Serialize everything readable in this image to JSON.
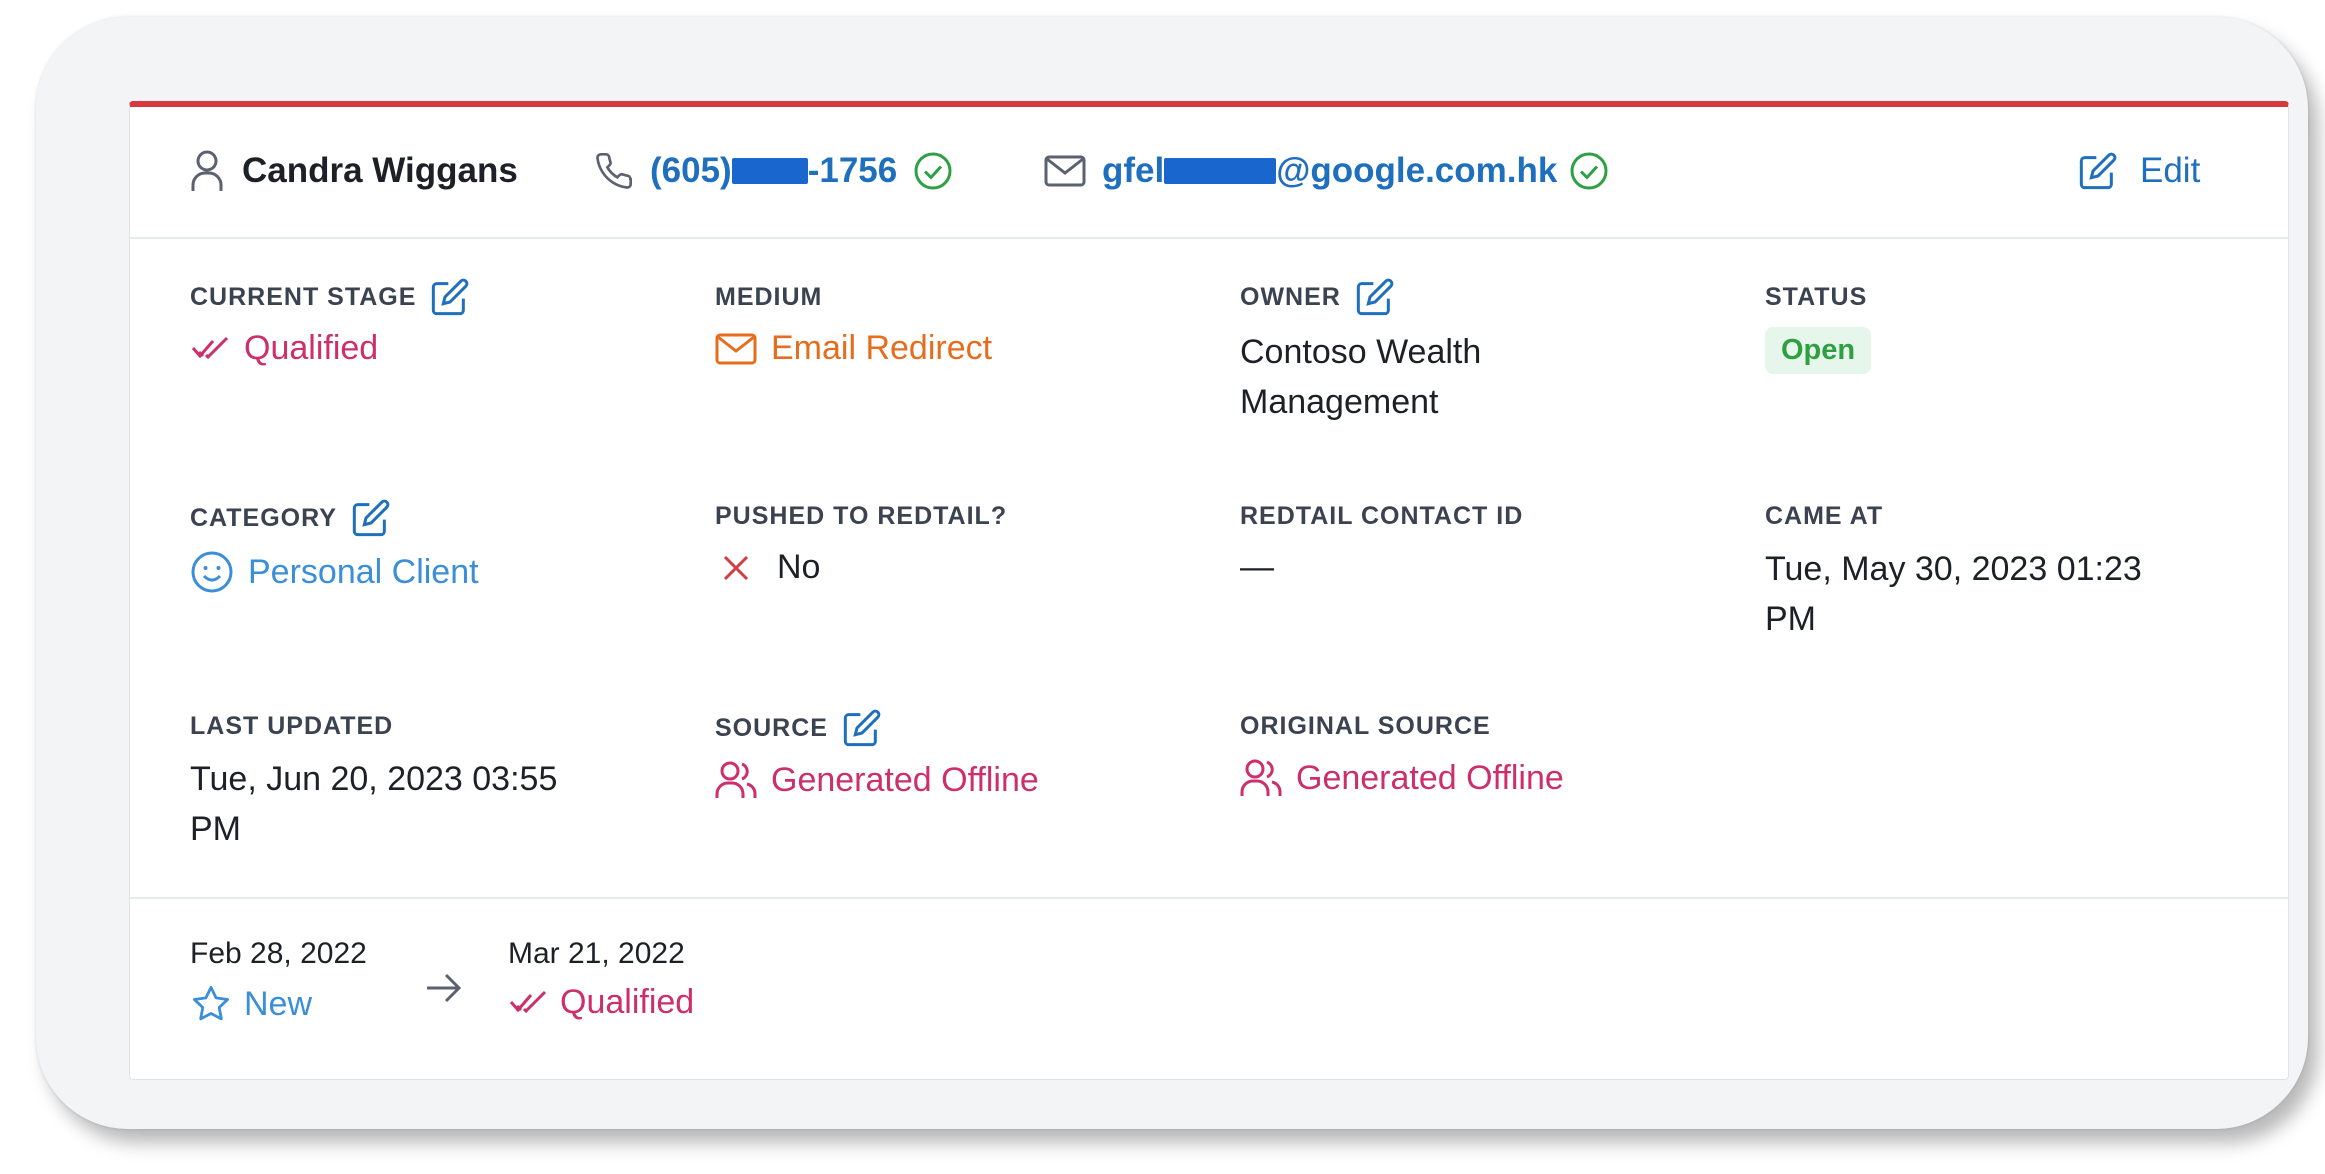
{
  "contact": {
    "name": "Candra Wiggans",
    "phone_prefix": "(605)",
    "phone_suffix": "-1756",
    "email_prefix": "gfel",
    "email_suffix": "@google.com.hk"
  },
  "header": {
    "edit_label": "Edit"
  },
  "fields": {
    "current_stage": {
      "label": "CURRENT STAGE",
      "value": "Qualified",
      "icon": "double-check-icon"
    },
    "medium": {
      "label": "MEDIUM",
      "value": "Email Redirect",
      "icon": "mail-icon"
    },
    "owner": {
      "label": "OWNER",
      "value_line1": "Contoso Wealth",
      "value_line2": "Management"
    },
    "status": {
      "label": "STATUS",
      "value": "Open"
    },
    "category": {
      "label": "CATEGORY",
      "value": "Personal Client",
      "icon": "smiley-icon"
    },
    "pushed_to_redtail": {
      "label": "PUSHED TO REDTAIL?",
      "value": "No",
      "icon": "x-icon"
    },
    "redtail_contact_id": {
      "label": "REDTAIL CONTACT ID",
      "value": "—"
    },
    "came_at": {
      "label": "CAME AT",
      "value_line1": "Tue, May 30, 2023 01:23",
      "value_line2": "PM"
    },
    "last_updated": {
      "label": "LAST UPDATED",
      "value_line1": "Tue, Jun 20, 2023 03:55",
      "value_line2": "PM"
    },
    "source": {
      "label": "SOURCE",
      "value": "Generated Offline",
      "icon": "users-icon"
    },
    "original_source": {
      "label": "ORIGINAL SOURCE",
      "value": "Generated Offline",
      "icon": "users-icon"
    }
  },
  "history": [
    {
      "date": "Feb 28, 2022",
      "stage": "New",
      "icon": "star-icon"
    },
    {
      "date": "Mar 21, 2022",
      "stage": "Qualified",
      "icon": "double-check-icon"
    }
  ],
  "colors": {
    "accent_red": "#d63a3f",
    "link_blue": "#1f6fbf",
    "stage_pink": "#cc2f6b",
    "medium_orange": "#e56e1e",
    "category_blue": "#3b8ed8",
    "status_green": "#2ea043",
    "verified_green": "#2ea043"
  }
}
